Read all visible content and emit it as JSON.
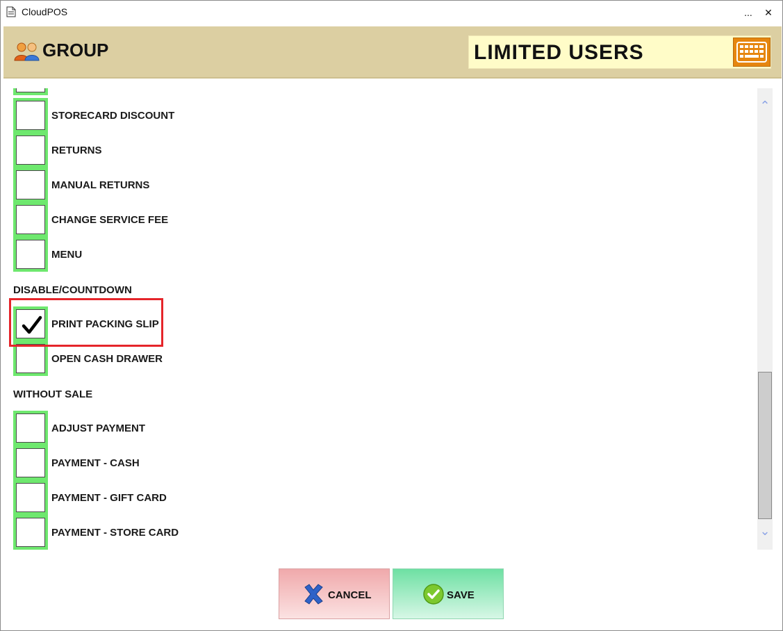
{
  "window": {
    "title": "CloudPOS",
    "more_label": "...",
    "close_label": "✕"
  },
  "header": {
    "title": "GROUP",
    "group_name": "LIMITED USERS"
  },
  "permissions": [
    {
      "label": "STORECARD DISCOUNT",
      "checked": false
    },
    {
      "label": "RETURNS",
      "checked": false
    },
    {
      "label": "MANUAL RETURNS",
      "checked": false
    },
    {
      "label": "CHANGE SERVICE FEE",
      "checked": false
    },
    {
      "label": "MENU",
      "checked": false
    },
    {
      "label": "PRINT PACKING SLIP",
      "checked": true
    },
    {
      "label": "OPEN CASH DRAWER",
      "checked": false
    },
    {
      "label": "ADJUST PAYMENT",
      "checked": false
    },
    {
      "label": "PAYMENT - CASH",
      "checked": false
    },
    {
      "label": "PAYMENT - GIFT CARD",
      "checked": false
    },
    {
      "label": "PAYMENT - STORE CARD",
      "checked": false
    }
  ],
  "sections": {
    "disable_countdown": "DISABLE/COUNTDOWN",
    "without_sale": "WITHOUT SALE"
  },
  "buttons": {
    "cancel": "CANCEL",
    "save": "SAVE"
  },
  "scroll": {
    "position_fraction": 0.66
  },
  "colors": {
    "checkbox_border": "#6ee86e",
    "highlight": "#e5252a",
    "header_bg": "#dccfa2",
    "keyboard_button": "#e6860f"
  }
}
